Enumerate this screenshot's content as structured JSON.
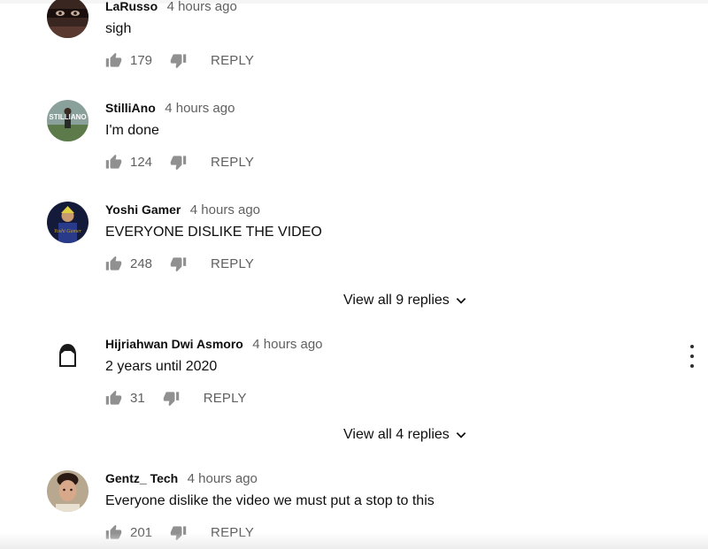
{
  "comments": [
    {
      "author": "LaRusso",
      "time": "4 hours ago",
      "text": "sigh",
      "likes": "179",
      "reply": "REPLY",
      "avatar": "avatar-larusso"
    },
    {
      "author": "StilliAno",
      "time": "4 hours ago",
      "text": "I'm done",
      "likes": "124",
      "reply": "REPLY",
      "avatar": "avatar-stilliano",
      "avatar_text": "STILLIANO"
    },
    {
      "author": "Yoshi Gamer",
      "time": "4 hours ago",
      "text": "EVERYONE DISLIKE THE VIDEO",
      "likes": "248",
      "reply": "REPLY",
      "avatar": "avatar-yoshi",
      "avatar_text": "Yoshi Gamer"
    },
    {
      "author": "Hijriahwan Dwi Asmoro",
      "time": "4 hours ago",
      "text": "2 years until 2020",
      "likes": "31",
      "reply": "REPLY",
      "avatar": "default-avatar-icon"
    },
    {
      "author": "Gentz_ Tech",
      "time": "4 hours ago",
      "text": "Everyone dislike the video we must put a stop to this",
      "likes": "201",
      "reply": "REPLY",
      "avatar": "avatar-gentz"
    }
  ],
  "view_replies": [
    {
      "label": "View all 9 replies"
    },
    {
      "label": "View all 4 replies"
    }
  ],
  "icons": {
    "like": "thumb-up-icon",
    "dislike": "thumb-down-icon",
    "expand": "chevron-down-icon",
    "menu": "more-vert-icon"
  },
  "colors": {
    "text_primary": "#0f0f0f",
    "text_secondary": "#606060",
    "icon": "#909090"
  }
}
